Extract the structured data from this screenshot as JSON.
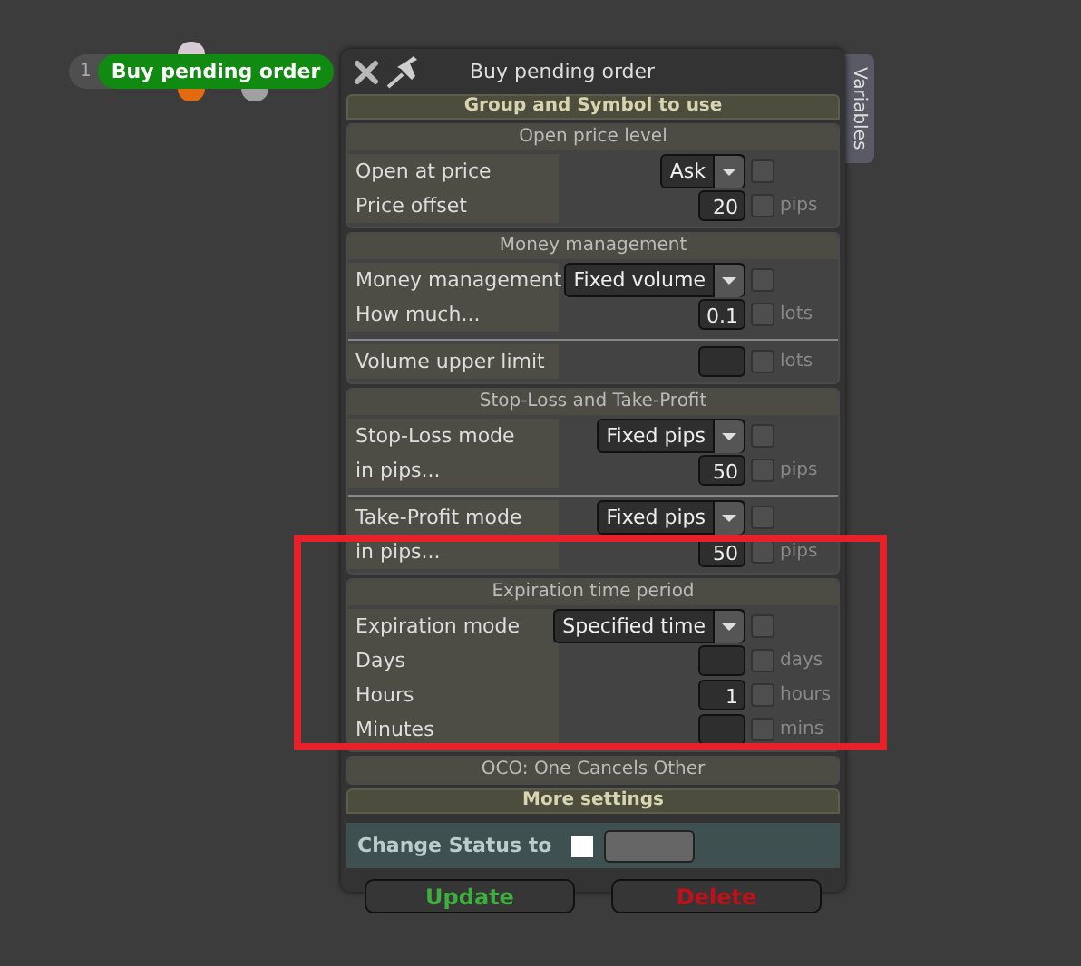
{
  "node": {
    "number": "1",
    "label": "Buy pending order"
  },
  "window": {
    "title": "Buy pending order",
    "side_tab": "Variables"
  },
  "sections": [
    {
      "kind": "header",
      "title": "Group and Symbol to use"
    },
    {
      "kind": "group",
      "title": "Open price level",
      "blocks": [
        [
          {
            "kind": "select",
            "label": "Open at price",
            "value": "Ask",
            "checked": false
          },
          {
            "kind": "number",
            "label": "Price offset",
            "value": "20",
            "unit": "pips",
            "checked": false
          }
        ]
      ]
    },
    {
      "kind": "group",
      "title": "Money management",
      "blocks": [
        [
          {
            "kind": "select",
            "label": "Money management",
            "value": "Fixed volume",
            "checked": false
          },
          {
            "kind": "number",
            "label": "How much...",
            "value": "0.1",
            "unit": "lots",
            "checked": false
          }
        ],
        [
          {
            "kind": "number",
            "label": "Volume upper limit",
            "unit": "lots",
            "checked": false
          }
        ]
      ]
    },
    {
      "kind": "group",
      "title": "Stop-Loss and Take-Profit",
      "blocks": [
        [
          {
            "kind": "select",
            "label": "Stop-Loss mode",
            "value": "Fixed pips",
            "checked": false
          },
          {
            "kind": "number",
            "label": "in pips...",
            "value": "50",
            "unit": "pips",
            "checked": false
          }
        ],
        [
          {
            "kind": "select",
            "label": "Take-Profit mode",
            "value": "Fixed pips",
            "checked": false
          },
          {
            "kind": "number",
            "label": "in pips...",
            "value": "50",
            "unit": "pips",
            "checked": false
          }
        ]
      ]
    },
    {
      "kind": "group",
      "title": "Expiration time period",
      "blocks": [
        [
          {
            "kind": "select",
            "label": "Expiration mode",
            "value": "Specified time",
            "checked": false
          },
          {
            "kind": "number",
            "label": "Days",
            "unit": "days",
            "checked": false
          },
          {
            "kind": "number",
            "label": "Hours",
            "value": "1",
            "unit": "hours",
            "checked": false
          },
          {
            "kind": "number",
            "label": "Minutes",
            "unit": "mins",
            "checked": false
          }
        ]
      ]
    },
    {
      "kind": "group",
      "title": "OCO: One Cancels Other"
    },
    {
      "kind": "header",
      "title": "More settings"
    }
  ],
  "status": {
    "label": "Change Status to",
    "checked": false
  },
  "buttons": [
    {
      "label": "Update",
      "color": "#3fae3f"
    },
    {
      "label": "Delete",
      "color": "#c0101a"
    }
  ]
}
